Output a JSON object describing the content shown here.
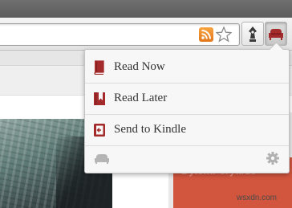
{
  "browser": {
    "toolbar": {
      "rss_icon": "rss-feed-icon",
      "star_icon": "bookmark-star-icon",
      "extensions": [
        {
          "name": "pen-nib-extension-icon"
        },
        {
          "name": "readability-couch-icon",
          "active": true
        }
      ]
    }
  },
  "popup": {
    "accent_color": "#a42b2b",
    "items": [
      {
        "label": "Read Now",
        "icon": "book-icon"
      },
      {
        "label": "Read Later",
        "icon": "bookmark-book-icon"
      },
      {
        "label": "Send to Kindle",
        "icon": "send-to-kindle-icon"
      }
    ],
    "footer": {
      "left_icon": "readability-couch-icon",
      "right_icon": "gear-icon"
    }
  },
  "background_page": {
    "promo_text": "DylemPeryarze",
    "watermark": "wsxdn.com"
  }
}
